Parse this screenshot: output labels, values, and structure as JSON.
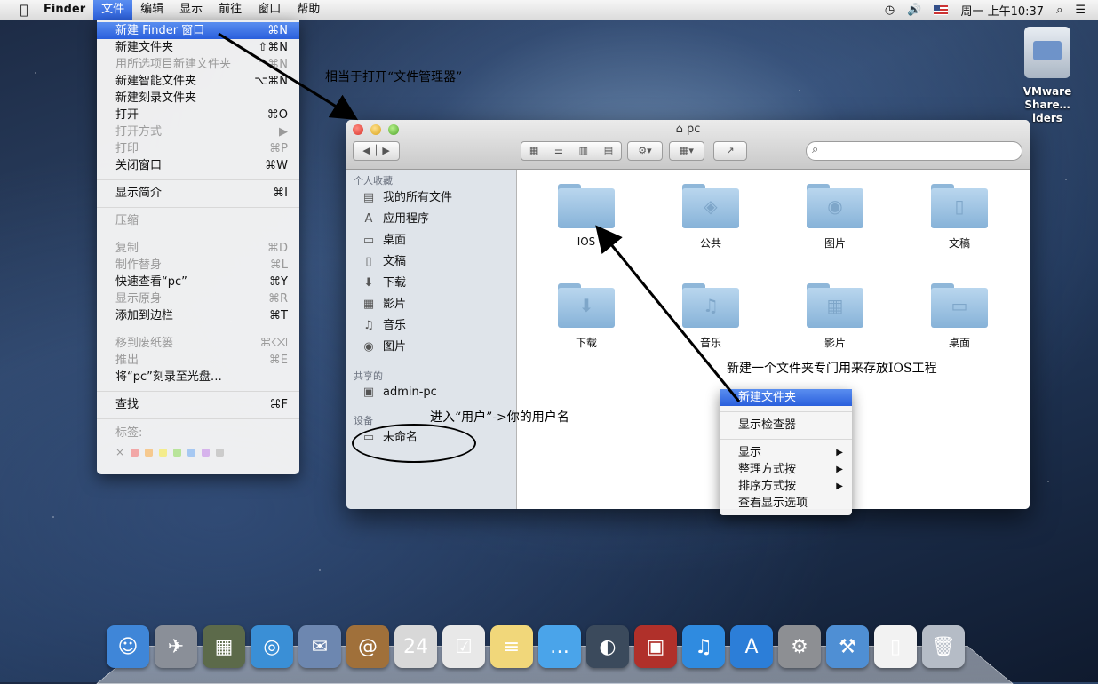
{
  "menubar": {
    "apple": "",
    "items": [
      "Finder",
      "文件",
      "编辑",
      "显示",
      "前往",
      "窗口",
      "帮助"
    ],
    "clock": "周一 上午10:37"
  },
  "file_menu": {
    "items": [
      {
        "label": "新建 Finder 窗口",
        "shortcut": "⌘N"
      },
      {
        "label": "新建文件夹",
        "shortcut": "⇧⌘N"
      },
      {
        "label": "用所选项目新建文件夹",
        "shortcut": "^⌘N"
      },
      {
        "label": "新建智能文件夹",
        "shortcut": "⌥⌘N"
      },
      {
        "label": "新建刻录文件夹",
        "shortcut": ""
      },
      {
        "label": "打开",
        "shortcut": "⌘O"
      },
      {
        "label": "打开方式",
        "shortcut": "▶"
      },
      {
        "label": "打印",
        "shortcut": "⌘P"
      },
      {
        "label": "关闭窗口",
        "shortcut": "⌘W"
      },
      {
        "label": "显示简介",
        "shortcut": "⌘I"
      },
      {
        "label": "压缩",
        "shortcut": ""
      },
      {
        "label": "复制",
        "shortcut": "⌘D"
      },
      {
        "label": "制作替身",
        "shortcut": "⌘L"
      },
      {
        "label": "快速查看“pc”",
        "shortcut": "⌘Y"
      },
      {
        "label": "显示原身",
        "shortcut": "⌘R"
      },
      {
        "label": "添加到边栏",
        "shortcut": "⌘T"
      },
      {
        "label": "移到废纸篓",
        "shortcut": "⌘⌫"
      },
      {
        "label": "推出",
        "shortcut": "⌘E"
      },
      {
        "label": "将“pc”刻录至光盘…",
        "shortcut": ""
      },
      {
        "label": "查找",
        "shortcut": "⌘F"
      },
      {
        "label": "标签:",
        "shortcut": ""
      }
    ],
    "tag_colors": [
      "#f2a7a7",
      "#f6c98f",
      "#f4ec8c",
      "#b8e49a",
      "#a6c8f2",
      "#d6b3ec",
      "#cccccc"
    ],
    "tag_close": "×"
  },
  "window": {
    "title": "pc",
    "sidebar": {
      "favorites_header": "个人收藏",
      "favorites": [
        {
          "label": "我的所有文件",
          "icon": "all-files-icon",
          "glyph": "▤"
        },
        {
          "label": "应用程序",
          "icon": "applications-icon",
          "glyph": "A"
        },
        {
          "label": "桌面",
          "icon": "desktop-icon",
          "glyph": "▭"
        },
        {
          "label": "文稿",
          "icon": "documents-icon",
          "glyph": "▯"
        },
        {
          "label": "下载",
          "icon": "downloads-icon",
          "glyph": "⬇"
        },
        {
          "label": "影片",
          "icon": "movies-icon",
          "glyph": "▦"
        },
        {
          "label": "音乐",
          "icon": "music-icon",
          "glyph": "♫"
        },
        {
          "label": "图片",
          "icon": "pictures-icon",
          "glyph": "◉"
        }
      ],
      "shared_header": "共享的",
      "shared": [
        {
          "label": "admin-pc",
          "icon": "computer-icon",
          "glyph": "▣"
        }
      ],
      "devices_header": "设备",
      "devices": [
        {
          "label": "未命名",
          "icon": "disk-icon",
          "glyph": "▭"
        }
      ]
    },
    "folders": [
      {
        "label": "IOS",
        "glyph": ""
      },
      {
        "label": "公共",
        "glyph": "◈"
      },
      {
        "label": "图片",
        "glyph": "◉"
      },
      {
        "label": "文稿",
        "glyph": "▯"
      },
      {
        "label": "下载",
        "glyph": "⬇"
      },
      {
        "label": "音乐",
        "glyph": "♫"
      },
      {
        "label": "影片",
        "glyph": "▦"
      },
      {
        "label": "桌面",
        "glyph": "▭"
      }
    ]
  },
  "context_menu": {
    "items": [
      {
        "label": "新建文件夹",
        "arrow": ""
      },
      {
        "label": "显示检查器",
        "arrow": ""
      },
      {
        "label": "显示",
        "arrow": "▶"
      },
      {
        "label": "整理方式按",
        "arrow": "▶"
      },
      {
        "label": "排序方式按",
        "arrow": "▶"
      },
      {
        "label": "查看显示选项",
        "arrow": ""
      }
    ]
  },
  "annotations": {
    "finder_note": "相当于打开“文件管理器”",
    "folder_note": "新建一个文件夹专门用来存放IOS工程",
    "user_note": "进入“用户”->你的用户名"
  },
  "desktop": {
    "drive_label_1": "VMware",
    "drive_label_2": "Share…lders"
  },
  "dock": {
    "icons": [
      {
        "name": "finder-icon",
        "glyph": "☺",
        "color": "#3f86d8"
      },
      {
        "name": "launchpad-icon",
        "glyph": "✈",
        "color": "#8a8f98"
      },
      {
        "name": "mission-control-icon",
        "glyph": "▦",
        "color": "#5c6a4a"
      },
      {
        "name": "safari-icon",
        "glyph": "◎",
        "color": "#3a8fd6"
      },
      {
        "name": "mail-icon",
        "glyph": "✉",
        "color": "#6d87b0"
      },
      {
        "name": "contacts-icon",
        "glyph": "@",
        "color": "#a0703a"
      },
      {
        "name": "calendar-icon",
        "glyph": "24",
        "color": "#d8d8d8"
      },
      {
        "name": "reminders-icon",
        "glyph": "☑",
        "color": "#e8e8e8"
      },
      {
        "name": "notes-icon",
        "glyph": "≡",
        "color": "#f1d77a"
      },
      {
        "name": "messages-icon",
        "glyph": "…",
        "color": "#4aa4ea"
      },
      {
        "name": "facetime-icon",
        "glyph": "◐",
        "color": "#3b4a5c"
      },
      {
        "name": "photo-booth-icon",
        "glyph": "▣",
        "color": "#b0302a"
      },
      {
        "name": "itunes-icon",
        "glyph": "♫",
        "color": "#2f8be0"
      },
      {
        "name": "app-store-icon",
        "glyph": "A",
        "color": "#2c7ed8"
      },
      {
        "name": "system-preferences-icon",
        "glyph": "⚙",
        "color": "#8d8f93"
      },
      {
        "name": "xcode-icon",
        "glyph": "⚒",
        "color": "#4f8fd4"
      },
      {
        "name": "document-icon",
        "glyph": "▯",
        "color": "#f2f2f2"
      },
      {
        "name": "trash-icon",
        "glyph": "🗑",
        "color": "#b5bcc6"
      }
    ]
  }
}
